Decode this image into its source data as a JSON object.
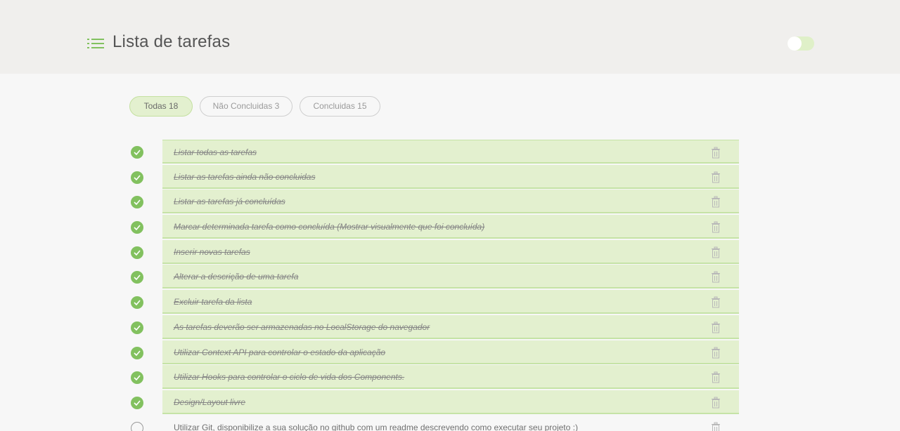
{
  "header": {
    "title": "Lista de tarefas",
    "icon": "list-icon",
    "theme_toggle": {
      "icon": "toggle-switch",
      "on": false
    }
  },
  "filters": [
    {
      "label": "Todas 18",
      "active": true
    },
    {
      "label": "Não Concluidas 3",
      "active": false
    },
    {
      "label": "Concluidas 15",
      "active": false
    }
  ],
  "tasks": [
    {
      "text": "Listar todas as tarefas",
      "done": true
    },
    {
      "text": "Listar as tarefas ainda não concluidas",
      "done": true
    },
    {
      "text": "Listar as tarefas já concluídas",
      "done": true
    },
    {
      "text": "Marcar determinada tarefa como concluída (Mostrar visualmente que foi concluída)",
      "done": true
    },
    {
      "text": " Inserir novas tarefas",
      "done": true
    },
    {
      "text": "Alterar a descrição de uma tarefa",
      "done": true
    },
    {
      "text": "Excluir tarefa da lista",
      "done": true
    },
    {
      "text": "As tarefas deverão ser armazenadas no LocalStorage do navegador",
      "done": true
    },
    {
      "text": "Utilizar Context API para controlar o estado da aplicação",
      "done": true
    },
    {
      "text": "Utilizar Hooks para controlar o ciclo de vida dos Components.",
      "done": true
    },
    {
      "text": "Design/Layout livre",
      "done": true
    },
    {
      "text": "Utilizar Git, disponibilize a sua solução no github com um readme descrevendo como executar seu projeto :)",
      "done": false
    }
  ],
  "colors": {
    "accent": "#82c15f",
    "done_background": "#e3f0cf",
    "done_border": "#c5e3a6",
    "header_background": "#f0efed",
    "page_background": "#f7f7f7"
  }
}
